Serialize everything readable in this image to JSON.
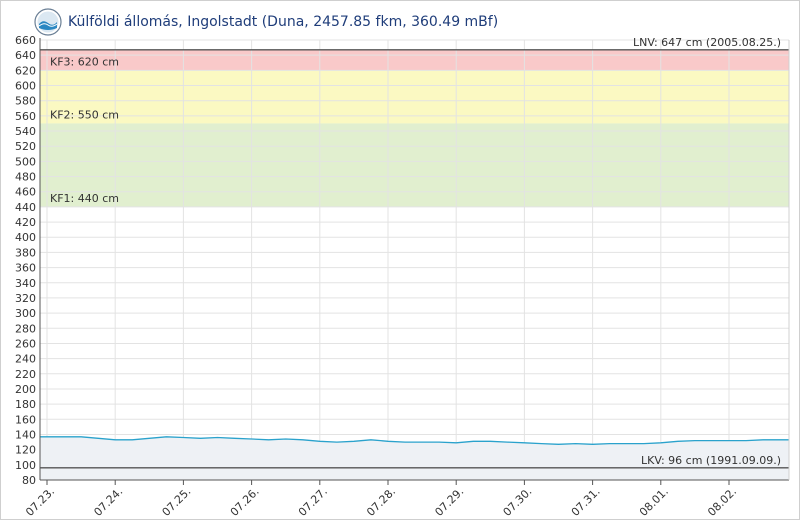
{
  "header": {
    "title": "Külföldi állomás, Ingolstadt (Duna, 2457.85 fkm, 360.49 mBf)",
    "logo_icon": "ovf-wave-logo-icon"
  },
  "chart_data": {
    "type": "line",
    "title": "Külföldi állomás, Ingolstadt (Duna, 2457.85 fkm, 360.49 mBf)",
    "xlabel": "",
    "ylabel": "",
    "ylim": [
      80,
      660
    ],
    "yticks": [
      80,
      100,
      120,
      140,
      160,
      180,
      200,
      220,
      240,
      260,
      280,
      300,
      320,
      340,
      360,
      380,
      400,
      420,
      440,
      460,
      480,
      500,
      520,
      540,
      560,
      580,
      600,
      620,
      640,
      660
    ],
    "x_tick_labels": [
      "07.23.",
      "07.24.",
      "07.25.",
      "07.26.",
      "07.27.",
      "07.28.",
      "07.29.",
      "07.30.",
      "07.31.",
      "08.01.",
      "08.02."
    ],
    "grid": true,
    "bands": [
      {
        "label": "KF3: 620 cm",
        "from": 620,
        "to": 647,
        "color": "#f9c9c9"
      },
      {
        "label": "KF2: 550 cm",
        "from": 550,
        "to": 620,
        "color": "#fbf9c2"
      },
      {
        "label": "KF1: 440 cm",
        "from": 440,
        "to": 550,
        "color": "#e1efcf"
      }
    ],
    "reference_lines": [
      {
        "label": "LNV: 647 cm (2005.08.25.)",
        "value": 647,
        "color": "#555555"
      },
      {
        "label": "LKV: 96 cm (1991.09.09.)",
        "value": 96,
        "color": "#555555"
      }
    ],
    "series": [
      {
        "color": "#2aa2cc",
        "fill": "#eef1f5",
        "x": [
          0,
          0.25,
          0.5,
          0.75,
          1.0,
          1.25,
          1.5,
          1.75,
          2.0,
          2.25,
          2.5,
          2.75,
          3.0,
          3.25,
          3.5,
          3.75,
          4.0,
          4.25,
          4.5,
          4.75,
          5.0,
          5.25,
          5.5,
          5.75,
          6.0,
          6.25,
          6.5,
          6.75,
          7.0,
          7.25,
          7.5,
          7.75,
          8.0,
          8.25,
          8.5,
          8.75,
          9.0,
          9.25,
          9.5,
          9.75,
          10.0,
          10.25,
          10.5,
          10.75
        ],
        "y": [
          137,
          137,
          137,
          135,
          133,
          133,
          135,
          137,
          136,
          135,
          136,
          135,
          134,
          133,
          134,
          133,
          131,
          130,
          131,
          133,
          131,
          130,
          130,
          130,
          129,
          131,
          131,
          130,
          129,
          128,
          127,
          128,
          127,
          128,
          128,
          128,
          129,
          131,
          132,
          132,
          132,
          132,
          133,
          133
        ]
      }
    ]
  }
}
